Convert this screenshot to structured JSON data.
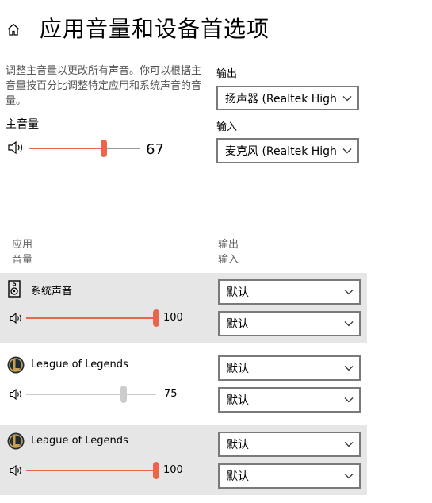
{
  "page": {
    "title": "应用音量和设备首选项",
    "description": "调整主音量以更改所有声音。你可以根据主音量按百分比调整特定应用和系统声音的音量。",
    "master_label": "主音量",
    "master_volume": 67
  },
  "devices": {
    "output_label": "输出",
    "output_value": "扬声器 (Realtek High Definition Audio)",
    "input_label": "输入",
    "input_value": "麦克风 (Realtek High Definition Audio)"
  },
  "columns": {
    "app_header": "应用",
    "volume_header": "音量",
    "output_header": "输出",
    "input_header": "输入"
  },
  "apps": [
    {
      "name": "系统声音",
      "volume": 100,
      "output": "默认",
      "input": "默认",
      "accent": "#e8674a",
      "highlighted": true
    },
    {
      "name": "League of Legends",
      "volume": 75,
      "output": "默认",
      "input": "默认",
      "accent": "#cccccc",
      "highlighted": false
    },
    {
      "name": "League of Legends",
      "volume": 100,
      "output": "默认",
      "input": "默认",
      "accent": "#e8674a",
      "highlighted": true
    }
  ],
  "colors": {
    "accent": "#e8674a",
    "band": "#e6e6e6",
    "muted_track": "#cccccc"
  }
}
